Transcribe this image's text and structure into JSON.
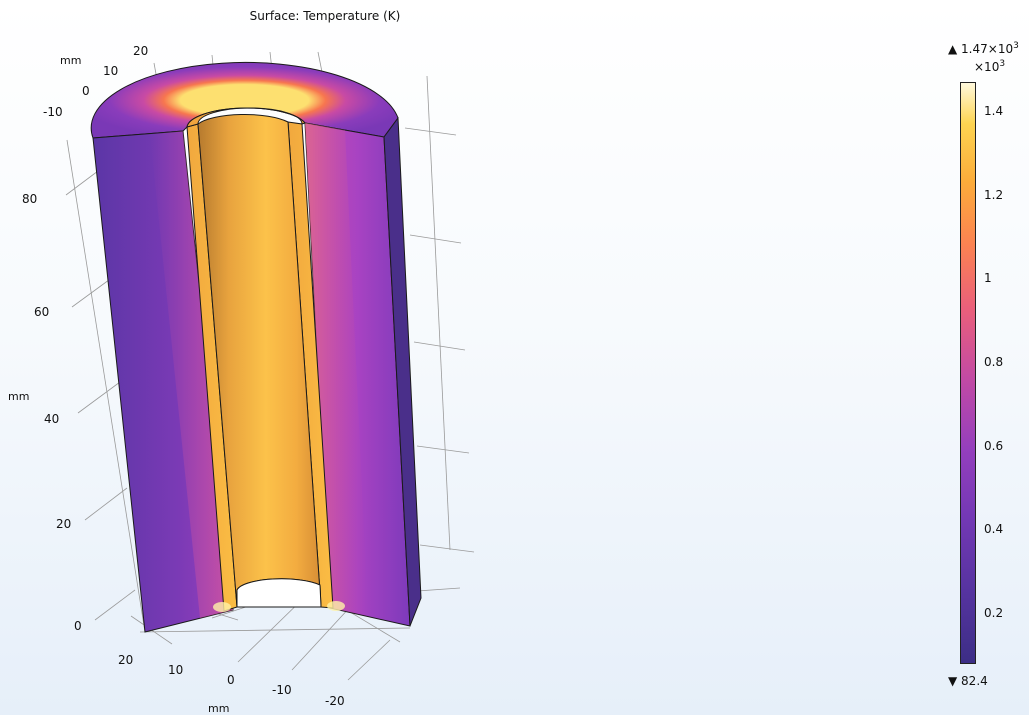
{
  "chart_data": {
    "type": "heatmap",
    "title": "Surface: Temperature (K)",
    "x_axis": {
      "label": "mm",
      "ticks": [
        "20",
        "10",
        "0",
        "-10",
        "-20"
      ]
    },
    "y_axis": {
      "label": "mm",
      "ticks": [
        "20",
        "10",
        "0",
        "-10"
      ]
    },
    "z_axis": {
      "label": "mm",
      "ticks": [
        "0",
        "20",
        "40",
        "60",
        "80"
      ],
      "range": [
        0,
        90
      ]
    },
    "colorbar": {
      "max_label": "1.47×10",
      "max_exponent": "3",
      "min_label": "82.4",
      "multiplier_label": "×10",
      "multiplier_exponent": "3",
      "min": 82.4,
      "max": 1470,
      "range_scaled": [
        0.0824,
        1.47
      ],
      "ticks": [
        "0.2",
        "0.4",
        "0.6",
        "0.8",
        "1",
        "1.2",
        "1.4"
      ],
      "tick_values": [
        0.2,
        0.4,
        0.6,
        0.8,
        1.0,
        1.2,
        1.4
      ],
      "colormap": [
        "#3c2e86",
        "#55339f",
        "#7338b5",
        "#953fbd",
        "#c24aa4",
        "#ea5f7b",
        "#fb8252",
        "#fcac3a",
        "#fdd451",
        "#fff9dc"
      ]
    }
  }
}
